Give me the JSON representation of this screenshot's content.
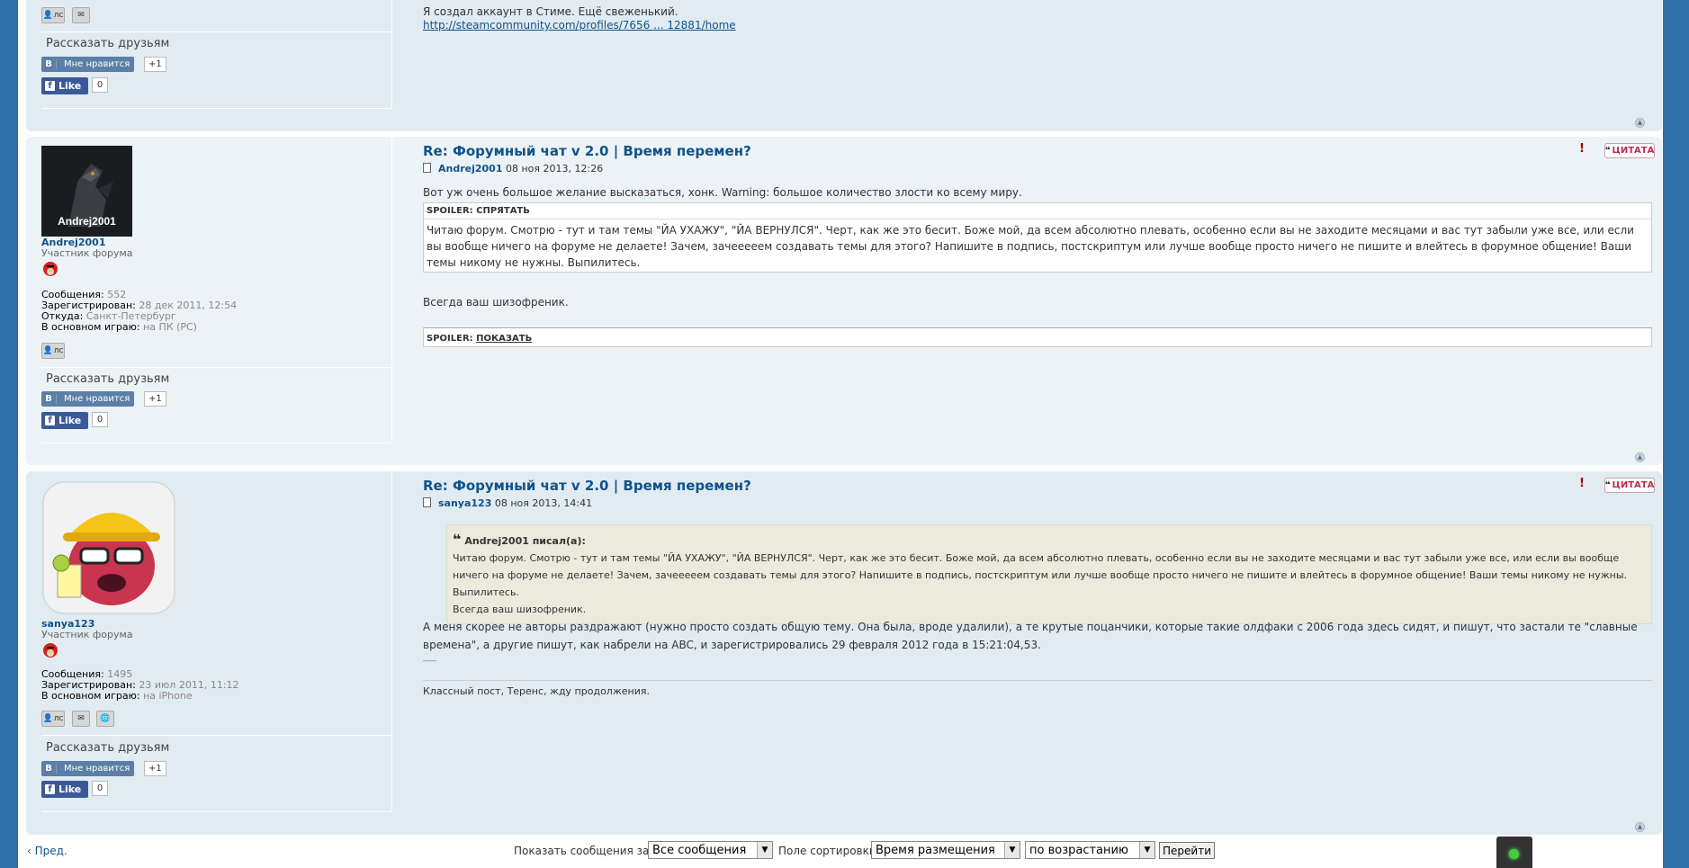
{
  "post0": {
    "text_line": "Я создал аккаунт в Стиме. Ещё свеженький.",
    "link": "http://steamcommunity.com/profiles/7656 ... 12881/home",
    "buttons": {
      "pm": "лс"
    },
    "share_title": "Рассказать друзьям",
    "vk_label": "Мне нравится",
    "vk_logo": "В",
    "vk_count": "+1",
    "fb_label": "Like",
    "fb_logo": "f",
    "fb_count": "0"
  },
  "post1": {
    "title": "Re: Форумный чат v 2.0 | Время перемен?",
    "author": "Andrej2001",
    "date": "08 ноя 2013, 12:26",
    "avatar_caption": "Andrej2001",
    "username": "Andrej2001",
    "rank": "Участник форума",
    "stats": {
      "posts_label": "Сообщения:",
      "posts": "552",
      "registered_label": "Зарегистрирован:",
      "registered": "28 дек 2011, 12:54",
      "location_label": "Откуда:",
      "location": "Санкт-Петербург",
      "plays_label": "В основном играю:",
      "plays": "на ПК (PC)"
    },
    "intro": "Вот уж очень большое желание высказаться, хонк. Warning: большое количество злости ко всему миру.",
    "spoiler1_head": "SPOILER: СПРЯТАТЬ",
    "spoiler1_body": "Читаю форум. Смотрю - тут и там темы \"ЙА УХАЖУ\", \"ЙА ВЕРНУЛСЯ\". Черт, как же это бесит. Боже мой, да всем абсолютно плевать, особенно если вы не заходите месяцами и вас тут забыли уже все, или если вы вообще ничего на форуме не делаете! Зачем, зачееееем создавать темы для этого? Напишите в подпись, постскриптум или лучше вообще просто ничего не пишите и влейтесь в форумное общение! Ваши темы никому не нужны. Выпилитесь.",
    "closing": "Всегда ваш шизофреник.",
    "spoiler2_label": "SPOILER:",
    "spoiler2_link": "ПОКАЗАТЬ",
    "report": "!",
    "quote_btn": "ЦИТАТА",
    "buttons": {
      "pm": "лс"
    },
    "share_title": "Рассказать друзьям",
    "vk_label": "Мне нравится",
    "vk_logo": "В",
    "vk_count": "+1",
    "fb_label": "Like",
    "fb_logo": "f",
    "fb_count": "0"
  },
  "post2": {
    "title": "Re: Форумный чат v 2.0 | Время перемен?",
    "author": "sanya123",
    "date": "08 ноя 2013, 14:41",
    "username": "sanya123",
    "rank": "Участник форума",
    "stats": {
      "posts_label": "Сообщения:",
      "posts": "1495",
      "registered_label": "Зарегистрирован:",
      "registered": "23 июл 2011, 11:12",
      "plays_label": "В основном играю:",
      "plays": "на iPhone"
    },
    "quote_author": "Andrej2001 писал(а):",
    "quote_text": "Читаю форум. Смотрю - тут и там темы \"ЙА УХАЖУ\", \"ЙА ВЕРНУЛСЯ\". Черт, как же это бесит. Боже мой, да всем абсолютно плевать, особенно если вы не заходите месяцами и вас тут забыли уже все, или если вы вообще ничего на форуме не делаете! Зачем, зачееееем создавать темы для этого? Напишите в подпись, постскриптум или лучше вообще просто ничего не пишите и влейтесь в форумное общение! Ваши темы никому не нужны. Выпилитесь.",
    "quote_closing": "Всегда ваш шизофреник.",
    "reply": "А меня скорее не авторы раздражают (нужно просто создать общую тему. Она была, вроде удалили), а те крутые поцанчики, которые такие олдфаки с 2006 года здесь сидят, и пишут, что застали те \"славные времена\", а другие пишут, как набрели на ABC, и зарегистрировались 29 февраля 2012 года в 15:21:04,53.",
    "dash": "___",
    "signature": "Классный пост, Теренс, жду продолжения.",
    "report": "!",
    "quote_btn": "ЦИТАТА",
    "buttons": {
      "pm": "лс"
    },
    "share_title": "Рассказать друзьям",
    "vk_label": "Мне нравится",
    "vk_logo": "В",
    "vk_count": "+1",
    "fb_label": "Like",
    "fb_logo": "f",
    "fb_count": "0"
  },
  "bottom": {
    "prev": "Пред.",
    "show_label": "Показать сообщения за:",
    "show_value": "Все сообщения",
    "sort_label": "Поле сортировки",
    "sort_value": "Время размещения",
    "order_value": "по возрастанию",
    "go": "Перейти"
  },
  "colors": {
    "page_bg": "#2f6ea8",
    "post_bg_a": "#e1ebf2",
    "post_bg_b": "#ecf3f7",
    "link": "#105289",
    "quote_bg": "#ebeadd",
    "vk": "#5b7fa6",
    "fb": "#3b5998"
  }
}
